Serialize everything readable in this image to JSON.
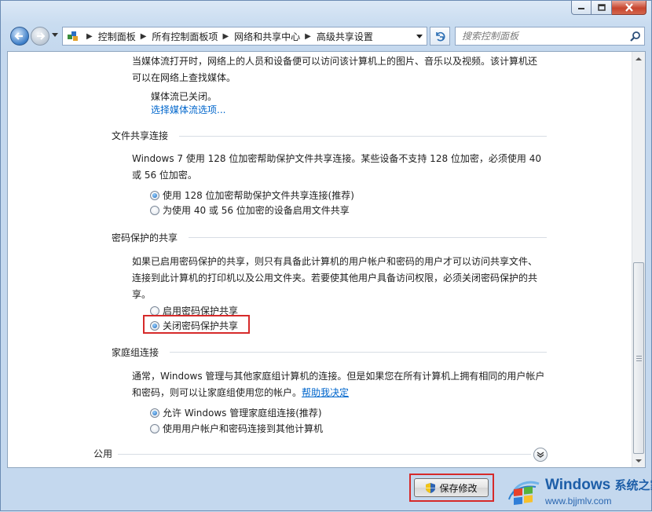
{
  "window": {
    "minimize_icon": "minimize-icon",
    "maximize_icon": "maximize-icon",
    "close_icon": "close-icon"
  },
  "nav": {
    "breadcrumbs": [
      "控制面板",
      "所有控制面板项",
      "网络和共享中心",
      "高级共享设置"
    ],
    "search_placeholder": "搜索控制面板"
  },
  "content": {
    "media_stream": {
      "desc_line1": "当媒体流打开时，网络上的人员和设备便可以访问该计算机上的图片、音乐以及视频。该计算机还",
      "desc_line2": "可以在网络上查找媒体。",
      "status": "媒体流已关闭。",
      "link": "选择媒体流选项..."
    },
    "file_sharing": {
      "title": "文件共享连接",
      "desc_line1": "Windows 7 使用 128 位加密帮助保护文件共享连接。某些设备不支持 128 位加密，必须使用 40",
      "desc_line2": "或 56 位加密。",
      "options": [
        {
          "label": "使用 128 位加密帮助保护文件共享连接(推荐)",
          "selected": true
        },
        {
          "label": "为使用 40 或 56 位加密的设备启用文件共享",
          "selected": false
        }
      ]
    },
    "password_sharing": {
      "title": "密码保护的共享",
      "desc_line1": "如果已启用密码保护的共享，则只有具备此计算机的用户帐户和密码的用户才可以访问共享文件、",
      "desc_line2": "连接到此计算机的打印机以及公用文件夹。若要使其他用户具备访问权限，必须关闭密码保护的共",
      "desc_line3": "享。",
      "options": [
        {
          "label": "启用密码保护共享",
          "selected": false
        },
        {
          "label": "关闭密码保护共享",
          "selected": true
        }
      ]
    },
    "homegroup": {
      "title": "家庭组连接",
      "desc_line1": "通常，Windows 管理与其他家庭组计算机的连接。但是如果您在所有计算机上拥有相同的用户帐户",
      "desc_line2_prefix": "和密码，则可以让家庭组使用您的帐户。",
      "help_link": "帮助我决定",
      "options": [
        {
          "label": "允许 Windows 管理家庭组连接(推荐)",
          "selected": true
        },
        {
          "label": "使用用户帐户和密码连接到其他计算机",
          "selected": false
        }
      ]
    },
    "public": {
      "title": "公用"
    }
  },
  "footer": {
    "save_label": "保存修改"
  },
  "watermark": {
    "brand": "Windows",
    "suffix": "系统之家",
    "url": "www.bjjmlv.com"
  },
  "colors": {
    "link": "#0066cc",
    "highlight_box": "#d62a2a",
    "watermark_blue": "#1d5ea8"
  }
}
